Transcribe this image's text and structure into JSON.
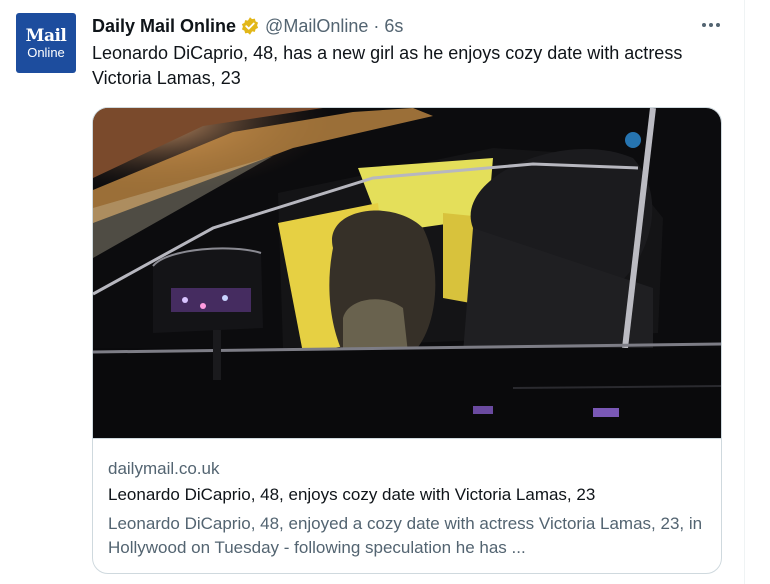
{
  "tweet": {
    "avatar": {
      "line1": "Mail",
      "line2": "Online"
    },
    "display_name": "Daily Mail Online",
    "handle": "@MailOnline",
    "separator": "·",
    "time": "6s",
    "text": "Leonardo DiCaprio, 48, has a new girl as he enjoys cozy date with actress Victoria Lamas, 23",
    "more_icon": "more-horizontal-icon",
    "verified_icon": "verified-badge-icon"
  },
  "card": {
    "domain": "dailymail.co.uk",
    "title": "Leonardo DiCaprio, 48, enjoys cozy date with Victoria Lamas, 23",
    "description": "Leonardo DiCaprio, 48, enjoyed a cozy date with actress Victoria Lamas, 23, in Hollywood on Tuesday - following speculation he has ..."
  },
  "colors": {
    "brand": "#1d4d9e",
    "verified_gold": "#e2b719",
    "secondary_text": "#536471",
    "border": "#cfd9de"
  }
}
